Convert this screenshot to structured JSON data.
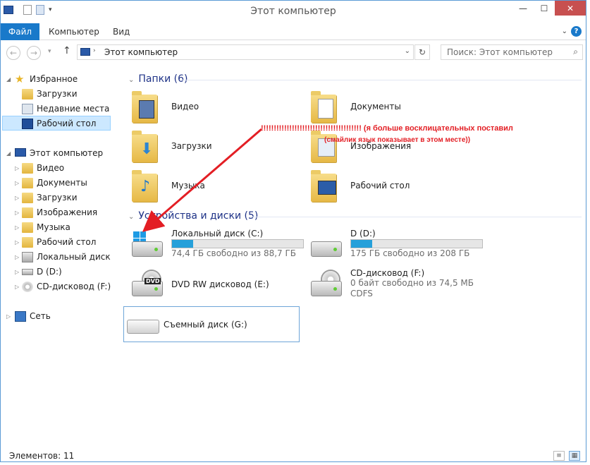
{
  "window": {
    "title": "Этот компьютер"
  },
  "ribbon": {
    "tabs": [
      "Файл",
      "Компьютер",
      "Вид"
    ]
  },
  "address": {
    "path": "Этот компьютер"
  },
  "search": {
    "placeholder": "Поиск: Этот компьютер"
  },
  "nav": {
    "favorites": {
      "label": "Избранное",
      "items": [
        "Загрузки",
        "Недавние места",
        "Рабочий стол"
      ]
    },
    "computer": {
      "label": "Этот компьютер",
      "items": [
        "Видео",
        "Документы",
        "Загрузки",
        "Изображения",
        "Музыка",
        "Рабочий стол",
        "Локальный диск (C:)",
        "D (D:)",
        "CD-дисковод (F:)"
      ]
    },
    "network": {
      "label": "Сеть"
    }
  },
  "folders": {
    "header": "Папки (6)",
    "items": [
      "Видео",
      "Документы",
      "Загрузки",
      "Изображения",
      "Музыка",
      "Рабочий стол"
    ]
  },
  "devices": {
    "header": "Устройства и диски (5)",
    "items": [
      {
        "name": "Локальный диск (C:)",
        "free": "74,4 ГБ свободно из 88,7 ГБ",
        "used_fraction": 0.16
      },
      {
        "name": "D (D:)",
        "free": "175 ГБ свободно из 208 ГБ",
        "used_fraction": 0.16
      },
      {
        "name": "DVD RW дисковод (E:)",
        "badge": "DVD"
      },
      {
        "name": "CD-дисковод (F:)",
        "free": "0 байт свободно из 74,5 МБ",
        "fs": "CDFS"
      },
      {
        "name": "Съемный диск (G:)"
      }
    ]
  },
  "annotation": {
    "line1": "!!!!!!!!!!!!!!!!!!!!!!!!!!!!!!!!!!!!!!! (я больше восклицательных поставил",
    "line2": "(смайлик язык показывает в этом месте))",
    "color": "#e31e24"
  },
  "status": {
    "items": "Элементов: 11"
  },
  "colors": {
    "accent": "#1979ca",
    "selection": "#cce8ff",
    "bar_fill": "#26a0da"
  }
}
